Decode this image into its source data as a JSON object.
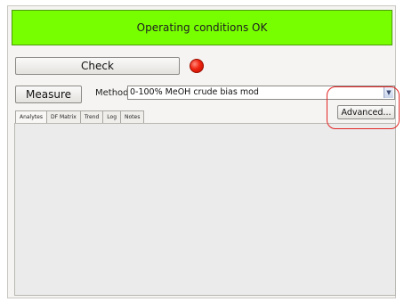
{
  "status": {
    "message": "Operating conditions OK",
    "color": "#77ff00"
  },
  "controls": {
    "check_label": "Check",
    "indicator_color": "#f0230f",
    "measure_label": "Measure",
    "method_label": "Method",
    "method_value": "0-100% MeOH crude bias mod",
    "advanced_label": "Advanced..."
  },
  "tabs": [
    {
      "label": "Analytes",
      "active": true
    },
    {
      "label": "DF Matrix",
      "active": false
    },
    {
      "label": "Trend",
      "active": false
    },
    {
      "label": "Log",
      "active": false
    },
    {
      "label": "Notes",
      "active": false
    }
  ],
  "annotation": {
    "color": "#e32626"
  }
}
